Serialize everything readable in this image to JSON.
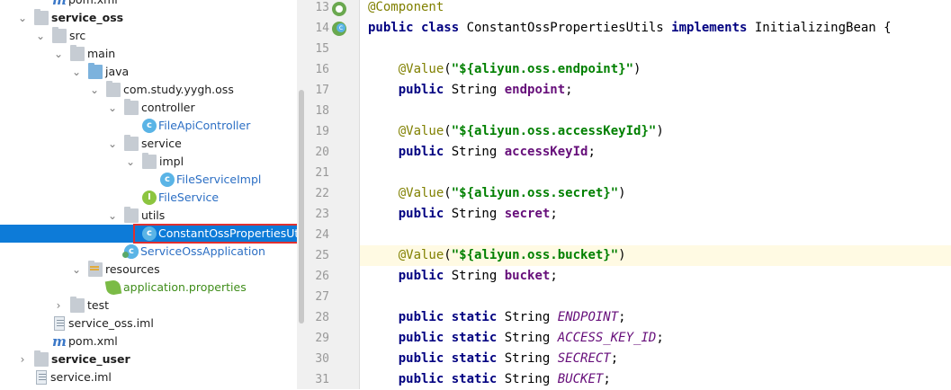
{
  "tree": {
    "top_partial": {
      "label": "pom.xml",
      "icon": "maven-icon"
    },
    "items": [
      {
        "label": "service_oss",
        "icon": "module-folder-icon"
      },
      {
        "label": "src",
        "icon": "folder-icon"
      },
      {
        "label": "main",
        "icon": "folder-icon"
      },
      {
        "label": "java",
        "icon": "source-folder-icon"
      },
      {
        "label": "com.study.yygh.oss",
        "icon": "package-icon"
      },
      {
        "label": "controller",
        "icon": "package-icon"
      },
      {
        "label": "FileApiController",
        "icon": "class-icon"
      },
      {
        "label": "service",
        "icon": "package-icon"
      },
      {
        "label": "impl",
        "icon": "package-icon"
      },
      {
        "label": "FileServiceImpl",
        "icon": "class-icon"
      },
      {
        "label": "FileService",
        "icon": "interface-icon"
      },
      {
        "label": "utils",
        "icon": "package-icon"
      },
      {
        "label": "ConstantOssPropertiesUtils",
        "icon": "class-icon"
      },
      {
        "label": "ServiceOssApplication",
        "icon": "spring-boot-class-icon"
      },
      {
        "label": "resources",
        "icon": "resources-folder-icon"
      },
      {
        "label": "application.properties",
        "icon": "spring-properties-icon"
      },
      {
        "label": "test",
        "icon": "folder-icon"
      },
      {
        "label": "service_oss.iml",
        "icon": "iml-file-icon"
      },
      {
        "label": "pom.xml",
        "icon": "maven-icon"
      },
      {
        "label": "service_user",
        "icon": "module-folder-icon"
      },
      {
        "label": "service.iml",
        "icon": "iml-file-icon"
      }
    ],
    "class_badge": "c",
    "interface_badge": "I",
    "maven_glyph": "m"
  },
  "editor": {
    "line_numbers": [
      "13",
      "14",
      "15",
      "16",
      "17",
      "18",
      "19",
      "20",
      "21",
      "22",
      "23",
      "24",
      "25",
      "26",
      "27",
      "28",
      "29",
      "30",
      "31"
    ],
    "highlighted_line": "25",
    "lines": [
      [
        {
          "t": "@Component",
          "c": "ann"
        }
      ],
      [
        {
          "t": "public class ",
          "c": "kw"
        },
        {
          "t": "ConstantOssPropertiesUtils ",
          "c": ""
        },
        {
          "t": "implements ",
          "c": "kw"
        },
        {
          "t": "InitializingBean {",
          "c": ""
        }
      ],
      [],
      [
        {
          "t": "    @Value",
          "c": "ann"
        },
        {
          "t": "(",
          "c": ""
        },
        {
          "t": "\"${aliyun.oss.endpoint}\"",
          "c": "str"
        },
        {
          "t": ")",
          "c": ""
        }
      ],
      [
        {
          "t": "    public ",
          "c": "kw"
        },
        {
          "t": "String ",
          "c": ""
        },
        {
          "t": "endpoint",
          "c": "fld"
        },
        {
          "t": ";",
          "c": ""
        }
      ],
      [],
      [
        {
          "t": "    @Value",
          "c": "ann"
        },
        {
          "t": "(",
          "c": ""
        },
        {
          "t": "\"${aliyun.oss.accessKeyId}\"",
          "c": "str"
        },
        {
          "t": ")",
          "c": ""
        }
      ],
      [
        {
          "t": "    public ",
          "c": "kw"
        },
        {
          "t": "String ",
          "c": ""
        },
        {
          "t": "accessKeyId",
          "c": "fld"
        },
        {
          "t": ";",
          "c": ""
        }
      ],
      [],
      [
        {
          "t": "    @Value",
          "c": "ann"
        },
        {
          "t": "(",
          "c": ""
        },
        {
          "t": "\"${aliyun.oss.secret}\"",
          "c": "str"
        },
        {
          "t": ")",
          "c": ""
        }
      ],
      [
        {
          "t": "    public ",
          "c": "kw"
        },
        {
          "t": "String ",
          "c": ""
        },
        {
          "t": "secret",
          "c": "fld"
        },
        {
          "t": ";",
          "c": ""
        }
      ],
      [],
      [
        {
          "t": "    @Value",
          "c": "ann"
        },
        {
          "t": "(",
          "c": ""
        },
        {
          "t": "\"${aliyun.oss.bucket}\"",
          "c": "str"
        },
        {
          "t": ")",
          "c": ""
        }
      ],
      [
        {
          "t": "    public ",
          "c": "kw"
        },
        {
          "t": "String ",
          "c": ""
        },
        {
          "t": "bucket",
          "c": "fld"
        },
        {
          "t": ";",
          "c": ""
        }
      ],
      [],
      [
        {
          "t": "    public static ",
          "c": "kw"
        },
        {
          "t": "String ",
          "c": ""
        },
        {
          "t": "ENDPOINT",
          "c": "sfld"
        },
        {
          "t": ";",
          "c": ""
        }
      ],
      [
        {
          "t": "    public static ",
          "c": "kw"
        },
        {
          "t": "String ",
          "c": ""
        },
        {
          "t": "ACCESS_KEY_ID",
          "c": "sfld"
        },
        {
          "t": ";",
          "c": ""
        }
      ],
      [
        {
          "t": "    public static ",
          "c": "kw"
        },
        {
          "t": "String ",
          "c": ""
        },
        {
          "t": "SECRECT",
          "c": "sfld"
        },
        {
          "t": ";",
          "c": ""
        }
      ],
      [
        {
          "t": "    public static ",
          "c": "kw"
        },
        {
          "t": "String ",
          "c": ""
        },
        {
          "t": "BUCKET",
          "c": "sfld"
        },
        {
          "t": ";",
          "c": ""
        }
      ]
    ]
  },
  "colors": {
    "selection": "#0d7bd8",
    "annotation_box": "#e0302f",
    "current_line": "#fffae3"
  }
}
